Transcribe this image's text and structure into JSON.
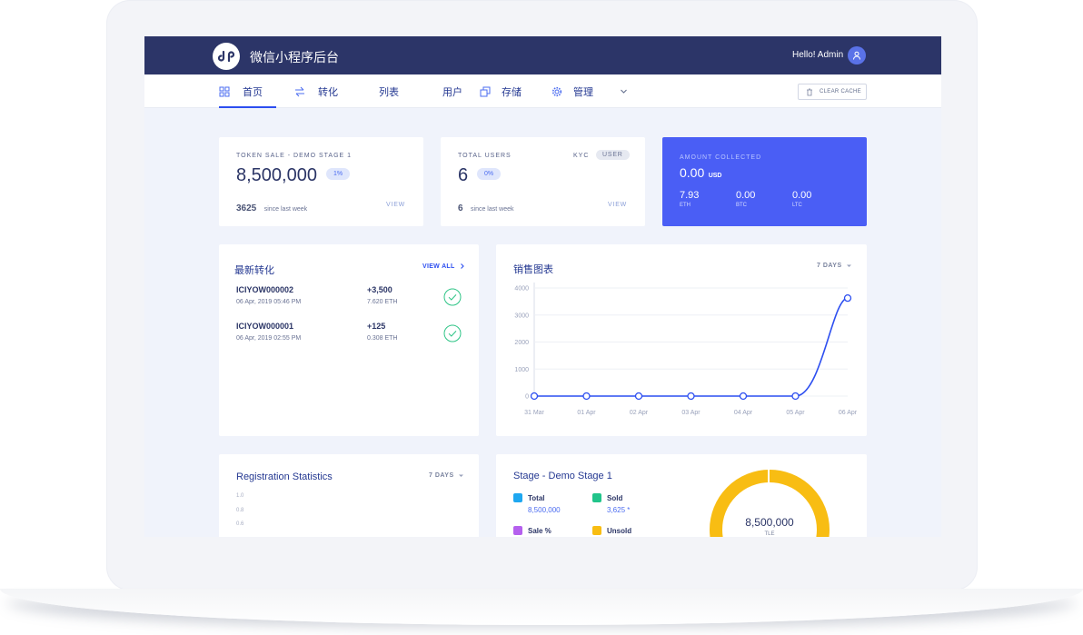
{
  "header": {
    "title": "微信小程序后台",
    "greeting": "Hello! Admin"
  },
  "nav": {
    "items": [
      {
        "label": "首页",
        "icon": "grid-icon",
        "active": true
      },
      {
        "label": "转化",
        "icon": "swap-icon"
      },
      {
        "label": "列表",
        "icon": "list-icon"
      },
      {
        "label": "用户",
        "icon": "user-icon"
      },
      {
        "label": "存储",
        "icon": "layers-icon"
      },
      {
        "label": "管理",
        "icon": "gear-icon"
      }
    ],
    "clear_cache": "CLEAR CACHE"
  },
  "token_card": {
    "label": "TOKEN SALE - DEMO STAGE 1",
    "value": "8,500,000",
    "badge": "1%",
    "since_num": "3625",
    "since_txt": "since last week",
    "link": "VIEW"
  },
  "users_card": {
    "label": "TOTAL USERS",
    "value": "6",
    "badge": "0%",
    "tag1": "KYC",
    "tag2": "USER",
    "since_num": "6",
    "since_txt": "since last week",
    "link": "VIEW"
  },
  "amount_card": {
    "label": "AMOUNT COLLECTED",
    "value": "0.00",
    "unit": "USD",
    "coins": [
      {
        "value": "7.93",
        "name": "ETH"
      },
      {
        "value": "0.00",
        "name": "BTC"
      },
      {
        "value": "0.00",
        "name": "LTC"
      }
    ]
  },
  "recent": {
    "title": "最新转化",
    "link": "VIEW ALL",
    "rows": [
      {
        "id": "ICIYOW000002",
        "date": "06 Apr, 2019 05:46 PM",
        "amount": "+3,500",
        "eth": "7.620 ETH"
      },
      {
        "id": "ICIYOW000001",
        "date": "06 Apr, 2019 02:55 PM",
        "amount": "+125",
        "eth": "0.308 ETH"
      }
    ]
  },
  "sales": {
    "title": "销售图表",
    "range": "7 DAYS"
  },
  "registration": {
    "title": "Registration Statistics",
    "range": "7 DAYS",
    "ticks": [
      "1.0",
      "0.8",
      "0.6"
    ]
  },
  "stage": {
    "title": "Stage - Demo Stage 1",
    "legend": [
      {
        "name": "Total",
        "value": "8,500,000",
        "color": "#1ea7f0"
      },
      {
        "name": "Sold",
        "value": "3,625 *",
        "color": "#21c48a"
      },
      {
        "name": "Sale %",
        "value": "",
        "color": "#b560ee"
      },
      {
        "name": "Unsold",
        "value": "",
        "color": "#f8bd13"
      }
    ],
    "donut_value": "8,500,000",
    "donut_unit": "TLE"
  },
  "chart_data": {
    "type": "line",
    "x": [
      "31 Mar",
      "01 Apr",
      "02 Apr",
      "03 Apr",
      "04 Apr",
      "05 Apr",
      "06 Apr"
    ],
    "series": [
      {
        "values": [
          0,
          0,
          0,
          0,
          0,
          0,
          3625
        ]
      }
    ],
    "yticks": [
      "4000",
      "3000",
      "2000",
      "1000",
      "0"
    ],
    "ylim": [
      0,
      4000
    ],
    "grid": true,
    "color": "#2c4ef0"
  },
  "colors": {
    "accent": "#2c4ef0",
    "header": "#2c3568",
    "amount_card": "#4a5ef5",
    "success": "#2ec486"
  }
}
